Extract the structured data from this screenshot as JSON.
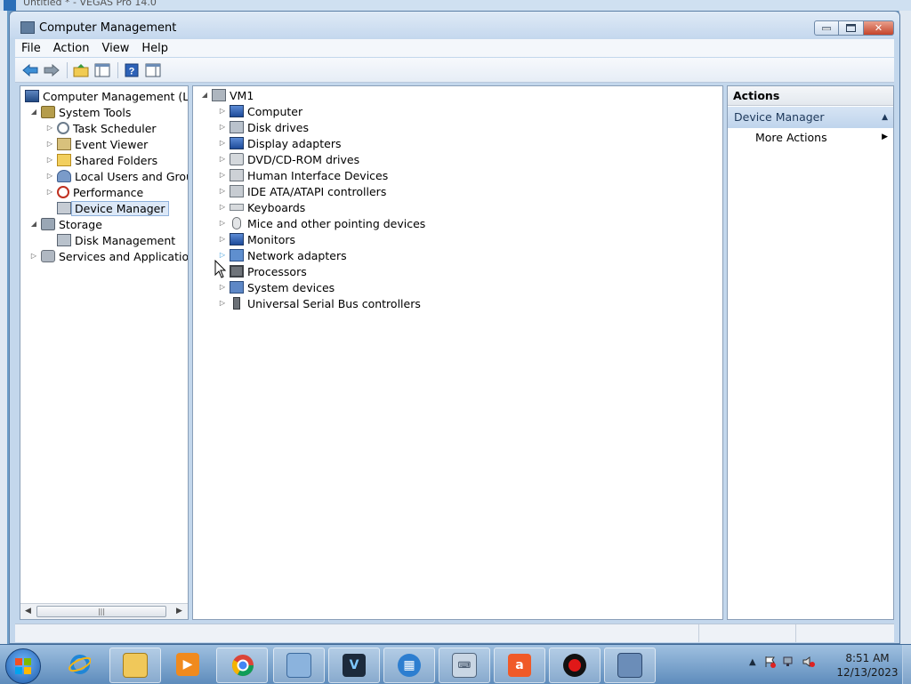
{
  "background_app": {
    "title": "Untitled * - VEGAS Pro 14.0"
  },
  "window": {
    "title": "Computer Management",
    "controls": {
      "minimize": "▭",
      "maximize": "□",
      "close": "✕"
    }
  },
  "menu": [
    "File",
    "Action",
    "View",
    "Help"
  ],
  "toolbar": {
    "buttons": [
      "back-icon",
      "forward-icon",
      "up-folder-icon",
      "show-hide-tree-icon",
      "help-icon",
      "show-hide-action-pane-icon"
    ]
  },
  "left_tree": {
    "root": "Computer Management (Local",
    "system_tools": "System Tools",
    "task_scheduler": "Task Scheduler",
    "event_viewer": "Event Viewer",
    "shared_folders": "Shared Folders",
    "local_users": "Local Users and Groups",
    "performance": "Performance",
    "device_manager": "Device Manager",
    "storage": "Storage",
    "disk_management": "Disk Management",
    "services": "Services and Applications"
  },
  "device_tree": {
    "root": "VM1",
    "categories": [
      "Computer",
      "Disk drives",
      "Display adapters",
      "DVD/CD-ROM drives",
      "Human Interface Devices",
      "IDE ATA/ATAPI controllers",
      "Keyboards",
      "Mice and other pointing devices",
      "Monitors",
      "Network adapters",
      "Processors",
      "System devices",
      "Universal Serial Bus controllers"
    ]
  },
  "actions_pane": {
    "header": "Actions",
    "section": "Device Manager",
    "more_actions": "More Actions"
  },
  "taskbar": {
    "apps": [
      "internet-explorer",
      "file-explorer",
      "media-player",
      "chrome",
      "remote-desktop",
      "vegas-pro",
      "video-editor",
      "on-screen-keyboard",
      "app-a",
      "screen-recorder",
      "computer-management"
    ],
    "time": "8:51 AM",
    "date": "12/13/2023"
  }
}
